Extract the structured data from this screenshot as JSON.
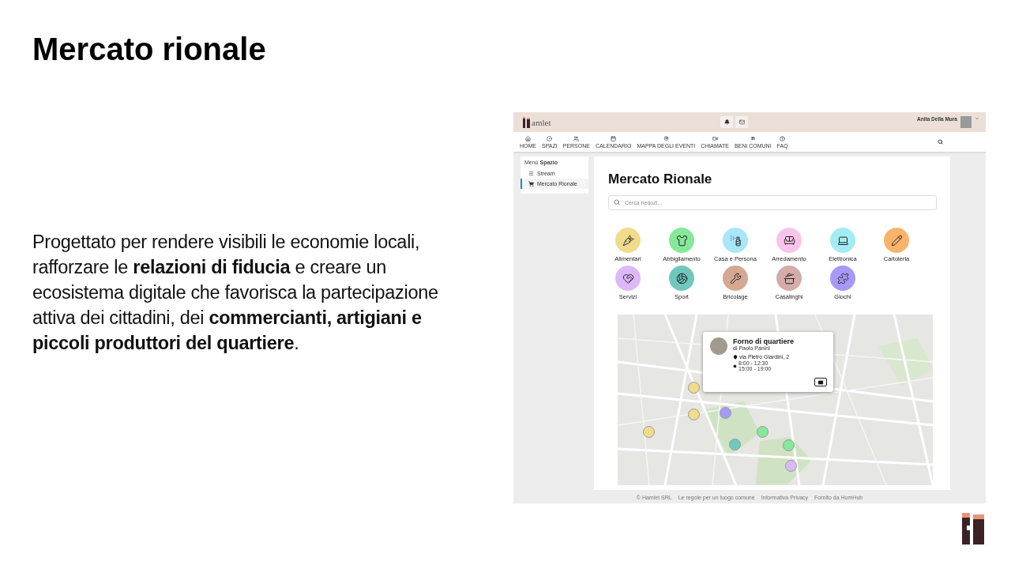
{
  "slide": {
    "title": "Mercato rionale",
    "paragraph": "Progettato per rendere visibili le economie locali, rafforzare le **relazioni di fiducia** e creare un ecosistema digitale che favorisca la partecipazione attiva dei cittadini, dei **commercianti, artigiani e piccoli produttori del quartiere**."
  },
  "app": {
    "brand": "amlet",
    "user": "Anita Della Mura",
    "nav": [
      {
        "label": "HOME",
        "selected": false
      },
      {
        "label": "SPAZI",
        "selected": false
      },
      {
        "label": "PERSONE",
        "selected": false
      },
      {
        "label": "CALENDARIO",
        "selected": false
      },
      {
        "label": "MAPPA DEGLI EVENTI",
        "selected": false
      },
      {
        "label": "CHIAMATE",
        "selected": false
      },
      {
        "label": "BENI COMUNI",
        "glyph": "B",
        "selected": false
      },
      {
        "label": "FAQ",
        "selected": false
      }
    ],
    "sidebar": {
      "heading_prefix": "Menù",
      "heading": "Spazio",
      "items": [
        {
          "label": "Stream",
          "selected": false
        },
        {
          "label": "Mercato Rionale",
          "selected": true
        }
      ]
    },
    "main": {
      "title": "Mercato Rionale",
      "search": {
        "placeholder": "Cerca negozi..."
      },
      "categories": [
        {
          "label": "Alimentari",
          "color": "#f0dc8c"
        },
        {
          "label": "Abbigliamento",
          "color": "#86e89a"
        },
        {
          "label": "Casa e Persona",
          "color": "#a8e6f8"
        },
        {
          "label": "Arredamento",
          "color": "#f8c4ec"
        },
        {
          "label": "Elettronica",
          "color": "#a4ecf4"
        },
        {
          "label": "Cartoleria",
          "color": "#f8b46c"
        },
        {
          "label": "Servizi",
          "color": "#dcb8f8"
        },
        {
          "label": "Sport",
          "color": "#70c8bc"
        },
        {
          "label": "Bricolage",
          "color": "#d4a894"
        },
        {
          "label": "Casalinghi",
          "color": "#d4aca8"
        },
        {
          "label": "Giochi",
          "color": "#a898f8"
        }
      ],
      "map": {
        "pins": [
          {
            "color": "#f0dc8c"
          },
          {
            "color": "#f0dc8c"
          },
          {
            "color": "#a898f8"
          },
          {
            "color": "#f0dc8c"
          },
          {
            "color": "#86e89a"
          },
          {
            "color": "#70c8bc"
          },
          {
            "color": "#86e89a"
          },
          {
            "color": "#dcb8f8"
          }
        ],
        "popup": {
          "title": "Forno di quartiere",
          "owner": "di Paolo Panini",
          "address": "via Pietro Giardini, 2",
          "hours": [
            "8:00 - 12:30",
            "15:00 - 19:00"
          ]
        }
      }
    },
    "footer": [
      "© Hamlet SRL",
      "Le regole per un luogo comune",
      "Informativa Privacy",
      "Fornito da HumHub"
    ]
  }
}
